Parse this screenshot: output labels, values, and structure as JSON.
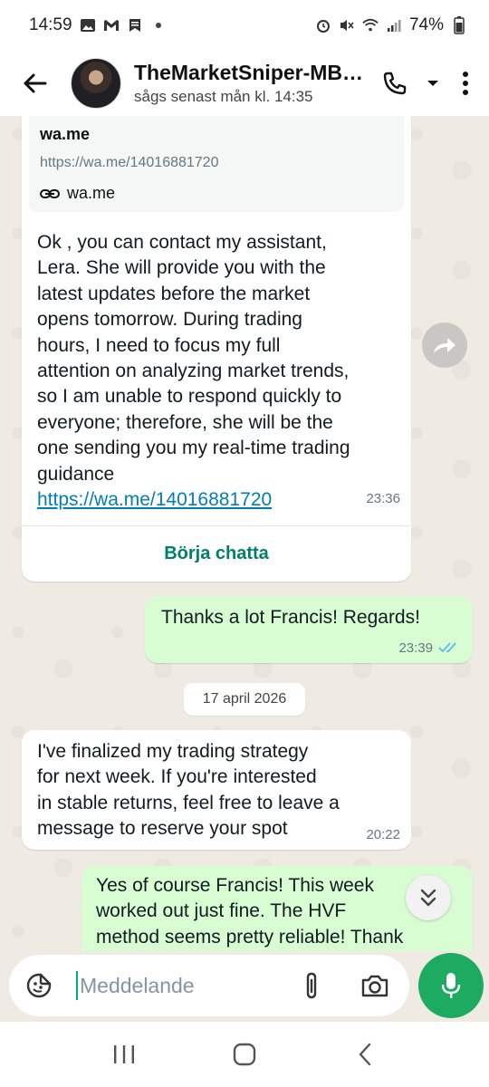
{
  "status_bar": {
    "time": "14:59",
    "battery": "74%",
    "icons": [
      "image-icon",
      "gmail-icon",
      "bookmark-icon",
      "alarm-icon",
      "mute-icon",
      "wifi-icon",
      "signal-icon",
      "battery-icon"
    ]
  },
  "header": {
    "contact_name": "TheMarketSniper-MB…",
    "last_seen": "sågs senast mån kl. 14:35",
    "icons": [
      "back-arrow-icon",
      "phone-icon",
      "dropdown-icon",
      "more-vert-icon"
    ]
  },
  "messages": {
    "first": {
      "preview_title": "wa.me",
      "preview_url": "https://wa.me/14016881720",
      "preview_domain": "wa.me",
      "lines": [
        "Ok , you can contact my assistant,",
        "Lera. She will provide you with the",
        "latest updates before the market",
        "opens tomorrow. During trading",
        "hours, I need to focus my full",
        "attention on analyzing market trends,",
        "so I am unable to respond quickly to",
        "everyone; therefore, she will be the",
        "one sending you my real-time trading",
        "guidance"
      ],
      "link": "https://wa.me/14016881720",
      "time": "23:36",
      "cta_label": "Börja chatta"
    },
    "reply_one": {
      "text": "Thanks a lot Francis! Regards!",
      "time": "23:39"
    },
    "date_divider": "17 april 2026",
    "second": {
      "lines": [
        "I've finalized my trading strategy",
        "for next week. If you're interested",
        "in stable returns, feel free to leave a",
        "message to reserve your spot"
      ],
      "time": "20:22"
    },
    "reply_two": {
      "lines": [
        "Yes of course Francis! This week",
        "worked out just fine. The HVF",
        "method seems pretty reliable! Thank"
      ]
    }
  },
  "composer": {
    "placeholder": "Meddelande"
  },
  "colors": {
    "accent": "#008069",
    "outgoing_bubble": "#d9fdd3",
    "mic_button": "#1daa61",
    "read_ticks": "#53bdeb"
  }
}
